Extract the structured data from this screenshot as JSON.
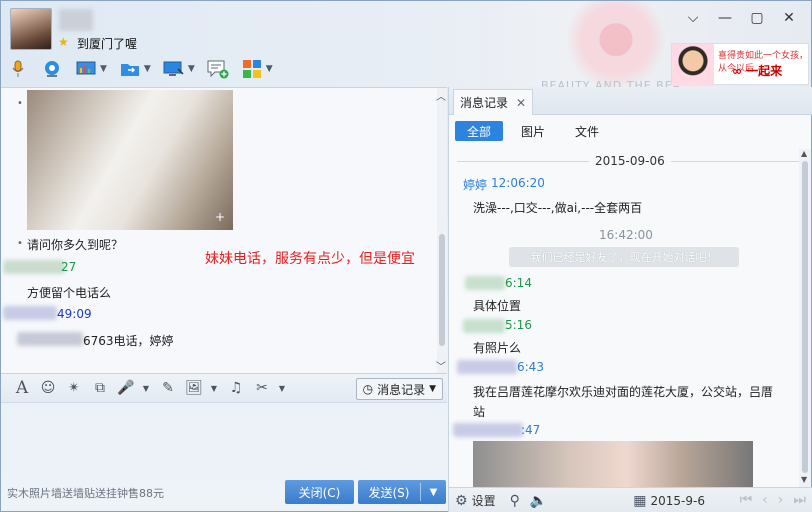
{
  "header": {
    "status_text": "到厦门了喔",
    "watermark_text": "BEAUTY AND THE BEA",
    "ad": {
      "text": "喜得贵如此一个女孩，从今以后",
      "logo": "∞ 一起来"
    }
  },
  "window_controls": {
    "menu_icon": "chevron-down-icon",
    "minimize_icon": "minimize-icon",
    "maximize_icon": "maximize-icon",
    "close_icon": "close-icon"
  },
  "toolbar": {
    "items": [
      {
        "name": "voice-call",
        "icon": "microphone-icon"
      },
      {
        "name": "video-call",
        "icon": "webcam-icon"
      },
      {
        "name": "app-board",
        "icon": "whiteboard-icon"
      },
      {
        "name": "file-transfer",
        "icon": "folder-arrow-icon"
      },
      {
        "name": "remote-desktop",
        "icon": "monitor-icon"
      },
      {
        "name": "create-group",
        "icon": "add-chat-icon"
      },
      {
        "name": "apps",
        "icon": "apps-grid-icon"
      }
    ]
  },
  "chat": {
    "messages": [
      {
        "text": "请问你多久到呢？"
      },
      {
        "sender_tail": "27"
      },
      {
        "text": "方便留个电话么"
      },
      {
        "sender_tail": "49:09"
      },
      {
        "text": "6763电话，婷婷"
      }
    ],
    "annotation": "妹妹电话，服务有点少，但是便宜"
  },
  "input_toolbar": {
    "history_label": "消息记录"
  },
  "footer": {
    "promo": "实木照片墙送墙贴送挂钟售88元",
    "close_label": "关闭(C)",
    "send_label": "发送(S)"
  },
  "history": {
    "tab_label": "消息记录",
    "filters": [
      "全部",
      "图片",
      "文件"
    ],
    "date": "2015-09-06",
    "entries": [
      {
        "sender": "婷婷",
        "time": "12:06:20",
        "text": "洗澡---,口交---,做ai,---全套两百"
      },
      {
        "center_time": "16:42:00"
      },
      {
        "notice": "我们已经是好友了，现在开始对话吧！"
      },
      {
        "sender_tail": "6:14",
        "text": "具体位置"
      },
      {
        "sender_tail": "5:16",
        "text": "有照片么"
      },
      {
        "sender_tail": "6:43",
        "text": "我在吕厝莲花摩尔欢乐迪对面的莲花大厦，公交站，吕厝站"
      },
      {
        "sender_tail": ":47"
      }
    ],
    "bottom": {
      "settings_label": "设置",
      "date_value": "2015-9-6"
    }
  }
}
